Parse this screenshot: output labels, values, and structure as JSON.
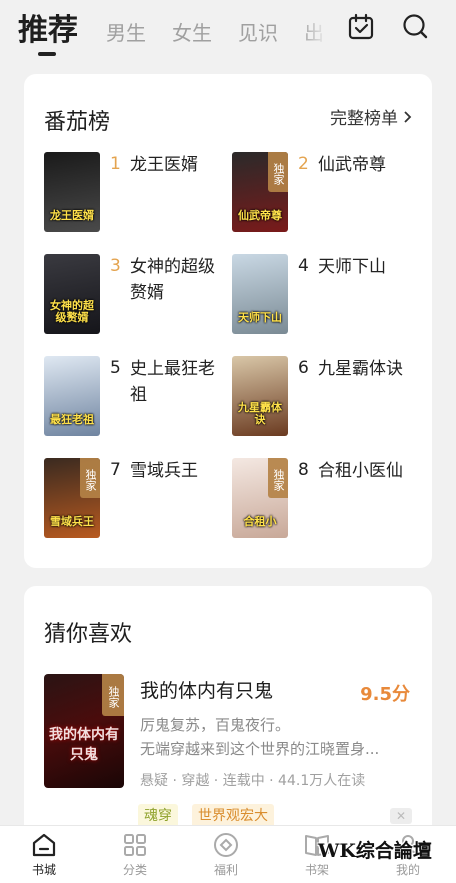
{
  "tabs": [
    {
      "label": "推荐",
      "active": true
    },
    {
      "label": "男生"
    },
    {
      "label": "女生"
    },
    {
      "label": "见识"
    },
    {
      "label": "出"
    }
  ],
  "header_icons": [
    "calendar-check-icon",
    "search-icon"
  ],
  "ranking": {
    "title": "番茄榜",
    "more_label": "完整榜单",
    "items": [
      {
        "rank": "1",
        "name": "龙王医婿",
        "cover_text": "龙王医婿",
        "exclusive": false,
        "cover_colors": [
          "#1a1a1a",
          "#4a4a4a"
        ]
      },
      {
        "rank": "2",
        "name": "仙武帝尊",
        "cover_text": "仙武帝尊",
        "exclusive": true,
        "cover_colors": [
          "#2a2a2a",
          "#7a1a1a"
        ]
      },
      {
        "rank": "3",
        "name": "女神的超级赘婿",
        "cover_text": "女神的超级赘婿",
        "exclusive": false,
        "cover_colors": [
          "#3a3a40",
          "#15151a"
        ]
      },
      {
        "rank": "4",
        "name": "天师下山",
        "cover_text": "天师下山",
        "exclusive": false,
        "cover_colors": [
          "#c9d8e4",
          "#7a8a94"
        ]
      },
      {
        "rank": "5",
        "name": "史上最狂老祖",
        "cover_text": "最狂老祖",
        "exclusive": false,
        "cover_colors": [
          "#dfe8f2",
          "#6f84a0"
        ]
      },
      {
        "rank": "6",
        "name": "九星霸体诀",
        "cover_text": "九星霸体诀",
        "exclusive": false,
        "cover_colors": [
          "#d9c7a8",
          "#6a3a20"
        ]
      },
      {
        "rank": "7",
        "name": "雪域兵王",
        "cover_text": "雪域兵王",
        "exclusive": true,
        "cover_colors": [
          "#3a2a20",
          "#b85a20"
        ]
      },
      {
        "rank": "8",
        "name": "合租小医仙",
        "cover_text": "合租小",
        "exclusive": true,
        "cover_colors": [
          "#f4e8e2",
          "#c8a898"
        ]
      }
    ]
  },
  "exclusive_label": "独家",
  "guess": {
    "title": "猜你喜欢",
    "book": {
      "title": "我的体内有只鬼",
      "score": "9.5分",
      "cover_text": "我的体内有只鬼",
      "desc_line1": "厉鬼复苏，百鬼夜行。",
      "desc_line2": "无端穿越来到这个世界的江晓置身...",
      "meta": "悬疑 · 穿越 · 连载中 · 44.1万人在读",
      "tags": [
        "魂穿",
        "世界观宏大"
      ]
    }
  },
  "bottom_nav": [
    {
      "label": "书城",
      "icon": "home-icon",
      "active": true
    },
    {
      "label": "分类",
      "icon": "grid-icon"
    },
    {
      "label": "福利",
      "icon": "coin-icon"
    },
    {
      "label": "书架",
      "icon": "bookshelf-icon"
    },
    {
      "label": "我的",
      "icon": "profile-icon"
    }
  ],
  "watermark": "WK综合論壇",
  "colors": {
    "background": "#f1f1f1",
    "top_rank_number": "#e4a450",
    "score": "#e8893a",
    "exclusive_badge": "#b48246"
  }
}
